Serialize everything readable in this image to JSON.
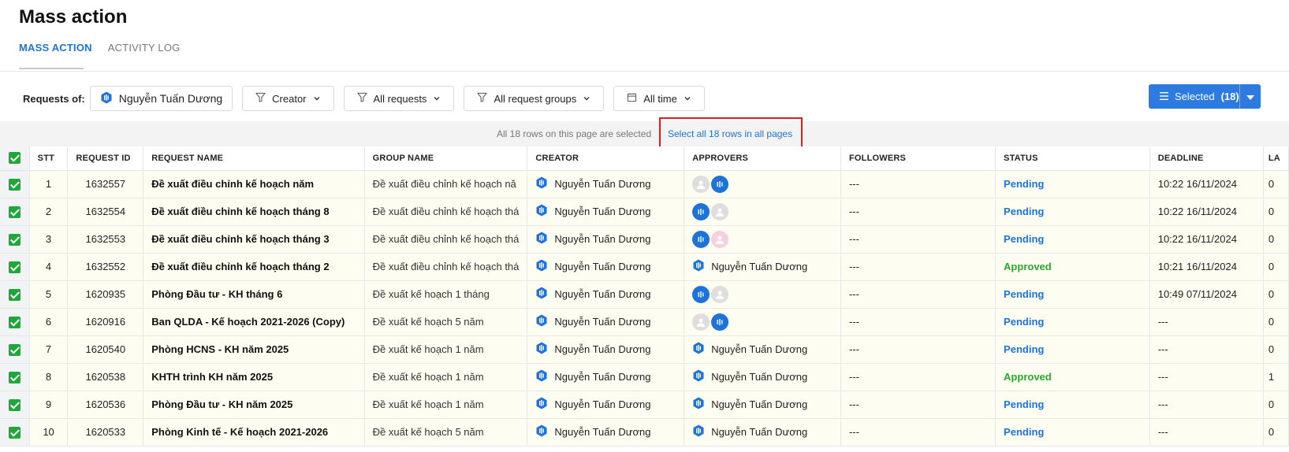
{
  "page": {
    "title": "Mass action"
  },
  "tabs": [
    {
      "label": "MASS ACTION",
      "active": true
    },
    {
      "label": "ACTIVITY LOG",
      "active": false
    }
  ],
  "filters": {
    "requests_of_label": "Requests of:",
    "user": "Nguyễn Tuấn Dương",
    "creator": "Creator",
    "requests": "All requests",
    "groups": "All request groups",
    "time": "All time"
  },
  "selected_button": {
    "label": "Selected",
    "count": "(18)"
  },
  "select_bar": {
    "info": "All 18 rows on this page are selected",
    "link": "Select all 18 rows in all pages"
  },
  "colors": {
    "accent": "#1e73d8",
    "approved": "#2da82d",
    "highlight_box": "#e01b1b",
    "checkbox": "#1fa83a"
  },
  "table": {
    "columns": [
      "STT",
      "REQUEST ID",
      "REQUEST NAME",
      "GROUP NAME",
      "CREATOR",
      "APPROVERS",
      "FOLLOWERS",
      "STATUS",
      "DEADLINE",
      "LA"
    ],
    "rows": [
      {
        "stt": "1",
        "id": "1632557",
        "name": "Đề xuất điều chỉnh kế hoạch năm",
        "group": "Đề xuất điều chỉnh kế hoạch nă",
        "creator": "Nguyễn Tuấn Dương",
        "approvers": {
          "avatars": [
            "gray",
            "blue"
          ]
        },
        "followers": "---",
        "status": "Pending",
        "deadline": "10:22 16/11/2024",
        "last": "0"
      },
      {
        "stt": "2",
        "id": "1632554",
        "name": "Đề xuất điều chỉnh kế hoạch tháng 8",
        "group": "Đề xuất điều chỉnh kế hoạch thá",
        "creator": "Nguyễn Tuấn Dương",
        "approvers": {
          "avatars": [
            "blue",
            "gray"
          ]
        },
        "followers": "---",
        "status": "Pending",
        "deadline": "10:22 16/11/2024",
        "last": "0"
      },
      {
        "stt": "3",
        "id": "1632553",
        "name": "Đề xuất điều chỉnh kế hoạch tháng 3",
        "group": "Đề xuất điều chỉnh kế hoạch thá",
        "creator": "Nguyễn Tuấn Dương",
        "approvers": {
          "avatars": [
            "blue",
            "pink"
          ]
        },
        "followers": "---",
        "status": "Pending",
        "deadline": "10:22 16/11/2024",
        "last": "0"
      },
      {
        "stt": "4",
        "id": "1632552",
        "name": "Đề xuất điều chỉnh kế hoạch tháng 2",
        "group": "Đề xuất điều chỉnh kế hoạch thá",
        "creator": "Nguyễn Tuấn Dương",
        "approvers": {
          "name": "Nguyễn Tuấn Dương"
        },
        "followers": "---",
        "status": "Approved",
        "deadline": "10:21 16/11/2024",
        "last": "0"
      },
      {
        "stt": "5",
        "id": "1620935",
        "name": "Phòng Đầu tư - KH tháng 6",
        "group": "Đề xuất kế hoạch 1 tháng",
        "creator": "Nguyễn Tuấn Dương",
        "approvers": {
          "avatars": [
            "blue",
            "gray"
          ]
        },
        "followers": "---",
        "status": "Pending",
        "deadline": "10:49 07/11/2024",
        "last": "0"
      },
      {
        "stt": "6",
        "id": "1620916",
        "name": "Ban QLDA - Kế hoạch 2021-2026 (Copy)",
        "group": "Đề xuất kế hoạch 5 năm",
        "creator": "Nguyễn Tuấn Dương",
        "approvers": {
          "avatars": [
            "gray",
            "blue"
          ]
        },
        "followers": "---",
        "status": "Pending",
        "deadline": "---",
        "last": "0"
      },
      {
        "stt": "7",
        "id": "1620540",
        "name": "Phòng HCNS - KH năm 2025",
        "group": "Đề xuất kế hoạch 1 năm",
        "creator": "Nguyễn Tuấn Dương",
        "approvers": {
          "name": "Nguyễn Tuấn Dương"
        },
        "followers": "---",
        "status": "Pending",
        "deadline": "---",
        "last": "0"
      },
      {
        "stt": "8",
        "id": "1620538",
        "name": "KHTH trình KH năm 2025",
        "group": "Đề xuất kế hoạch 1 năm",
        "creator": "Nguyễn Tuấn Dương",
        "approvers": {
          "name": "Nguyễn Tuấn Dương"
        },
        "followers": "---",
        "status": "Approved",
        "deadline": "---",
        "last": "1"
      },
      {
        "stt": "9",
        "id": "1620536",
        "name": "Phòng Đầu tư - KH năm 2025",
        "group": "Đề xuất kế hoạch 1 năm",
        "creator": "Nguyễn Tuấn Dương",
        "approvers": {
          "name": "Nguyễn Tuấn Dương"
        },
        "followers": "---",
        "status": "Pending",
        "deadline": "---",
        "last": "0"
      },
      {
        "stt": "10",
        "id": "1620533",
        "name": "Phòng Kinh tế - Kế hoạch 2021-2026",
        "group": "Đề xuất kế hoạch 5 năm",
        "creator": "Nguyễn Tuấn Dương",
        "approvers": {
          "name": "Nguyễn Tuấn Dương"
        },
        "followers": "---",
        "status": "Pending",
        "deadline": "---",
        "last": "0"
      }
    ]
  }
}
